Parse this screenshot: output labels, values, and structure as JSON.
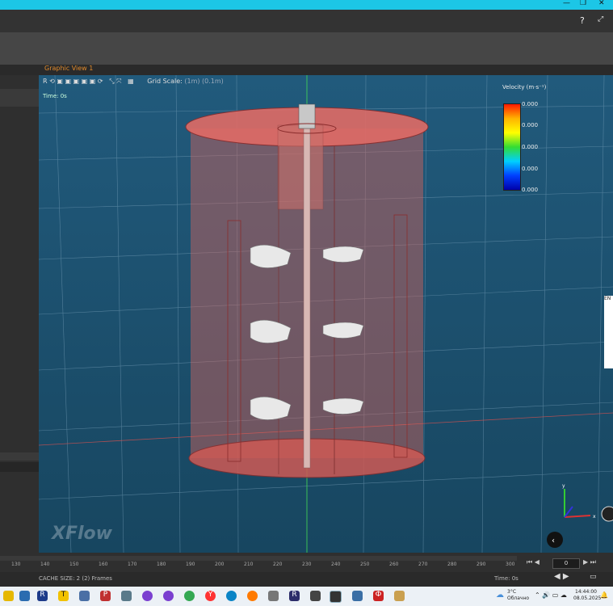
{
  "window": {
    "controls": [
      "—",
      "❐",
      "✕"
    ]
  },
  "view": {
    "title": "Graphic View 1",
    "grid_scale_label": "Grid Scale:",
    "grid_scale_value": "(1m) (0.1m)",
    "time_label": "Time: 0s",
    "legend": {
      "title": "Velocity (m·s⁻¹)",
      "ticks": [
        "0.000",
        "0.000",
        "0.000",
        "0.000",
        "0.000"
      ]
    },
    "axes": {
      "y": "y",
      "x": "x"
    },
    "watermark": "XFlow",
    "en_label": "EN"
  },
  "timeline": {
    "ticks": [
      "130",
      "140",
      "150",
      "160",
      "170",
      "180",
      "190",
      "200",
      "210",
      "220",
      "230",
      "240",
      "250",
      "260",
      "270",
      "280",
      "290",
      "300"
    ],
    "cache_size": "CACHE SIZE: 2 (2) Frames",
    "time": "Time: 0s",
    "frame": "0"
  },
  "taskbar": {
    "weather_temp": "3°C",
    "weather_text": "Облачно",
    "clock_time": "14:44:00",
    "clock_date": "08.05.2025",
    "icons": [
      "R",
      "T",
      "P",
      "Ф",
      "R",
      "Y"
    ]
  },
  "colors": {
    "accent": "#1cc6e6",
    "orange": "#e08a2c",
    "view_bg": "#1d4f6e",
    "tank": "#d9635c"
  }
}
